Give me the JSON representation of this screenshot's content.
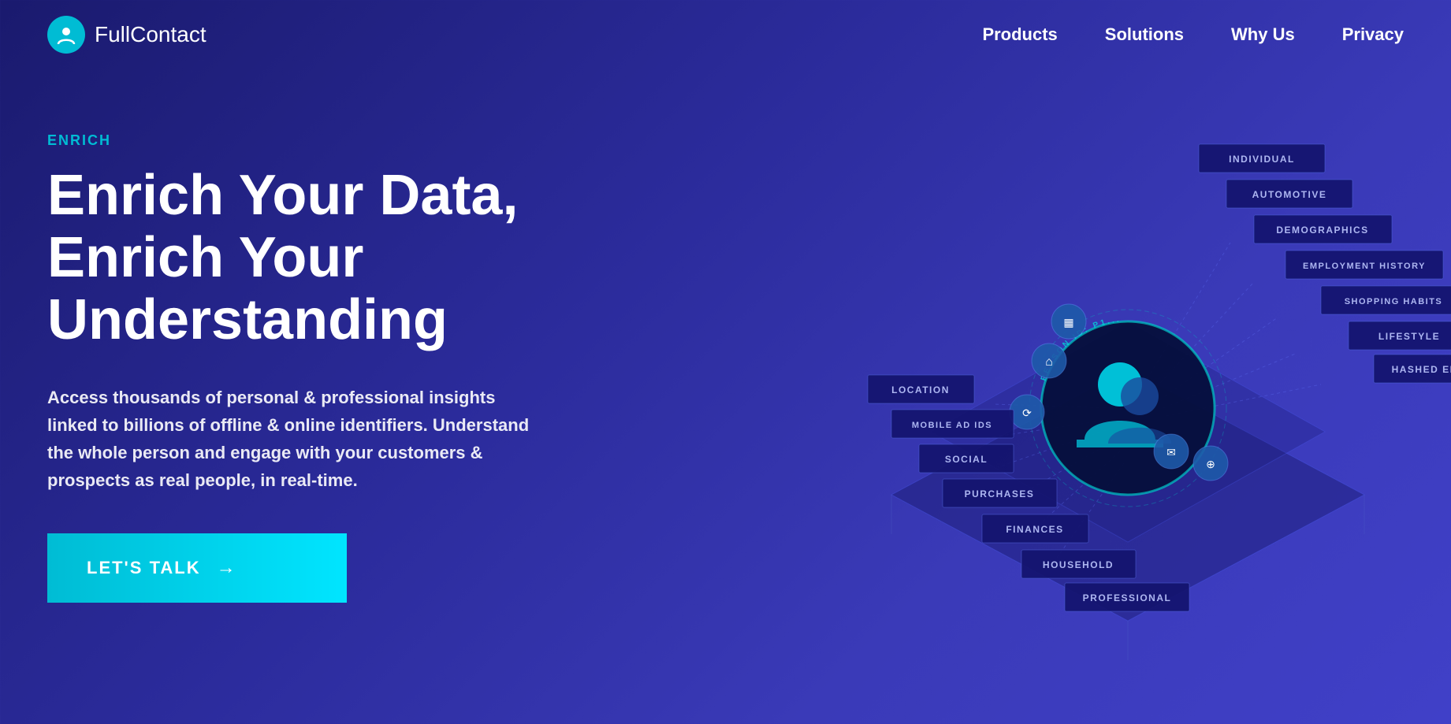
{
  "nav": {
    "logo_text_bold": "Full",
    "logo_text_light": "Contact",
    "links": [
      {
        "id": "products",
        "label": "Products"
      },
      {
        "id": "solutions",
        "label": "Solutions"
      },
      {
        "id": "why-us",
        "label": "Why Us"
      },
      {
        "id": "privacy",
        "label": "Privacy"
      }
    ]
  },
  "hero": {
    "enrich_label": "ENRICH",
    "title_line1": "Enrich Your Data,",
    "title_line2": "Enrich Your",
    "title_line3": "Understanding",
    "description": "Access thousands of personal & professional insights linked to billions of offline & online identifiers. Understand the whole person and engage with your customers & prospects as real people, in real-time.",
    "cta_label": "LET'S TALK",
    "cta_arrow": "→"
  },
  "graphic": {
    "data_cards": [
      {
        "id": "individual",
        "label": "INDIVIDUAL"
      },
      {
        "id": "automotive",
        "label": "AUTOMOTIVE"
      },
      {
        "id": "demographics",
        "label": "DEMOGRAPHICS"
      },
      {
        "id": "employment",
        "label": "EMPLOYMENT HISTORY"
      },
      {
        "id": "shopping",
        "label": "SHOPPING HABITS"
      },
      {
        "id": "lifestyle",
        "label": "LIFESTYLE"
      },
      {
        "id": "hashed",
        "label": "HASHED EMAILS"
      },
      {
        "id": "location",
        "label": "LOCATION"
      },
      {
        "id": "mobile",
        "label": "MOBILE AD IDS"
      },
      {
        "id": "social",
        "label": "SOCIAL"
      },
      {
        "id": "purchases",
        "label": "PURCHASES"
      },
      {
        "id": "finances",
        "label": "FINANCES"
      },
      {
        "id": "household",
        "label": "HOUSEHOLD"
      },
      {
        "id": "professional",
        "label": "PROFESSIONAL"
      }
    ],
    "person_id_label": "PERSON ID: P1..."
  },
  "colors": {
    "accent_cyan": "#00bcd4",
    "background_dark": "#1a1a6e",
    "background_mid": "#2b2b9b",
    "card_bg": "#1e1e8a"
  }
}
